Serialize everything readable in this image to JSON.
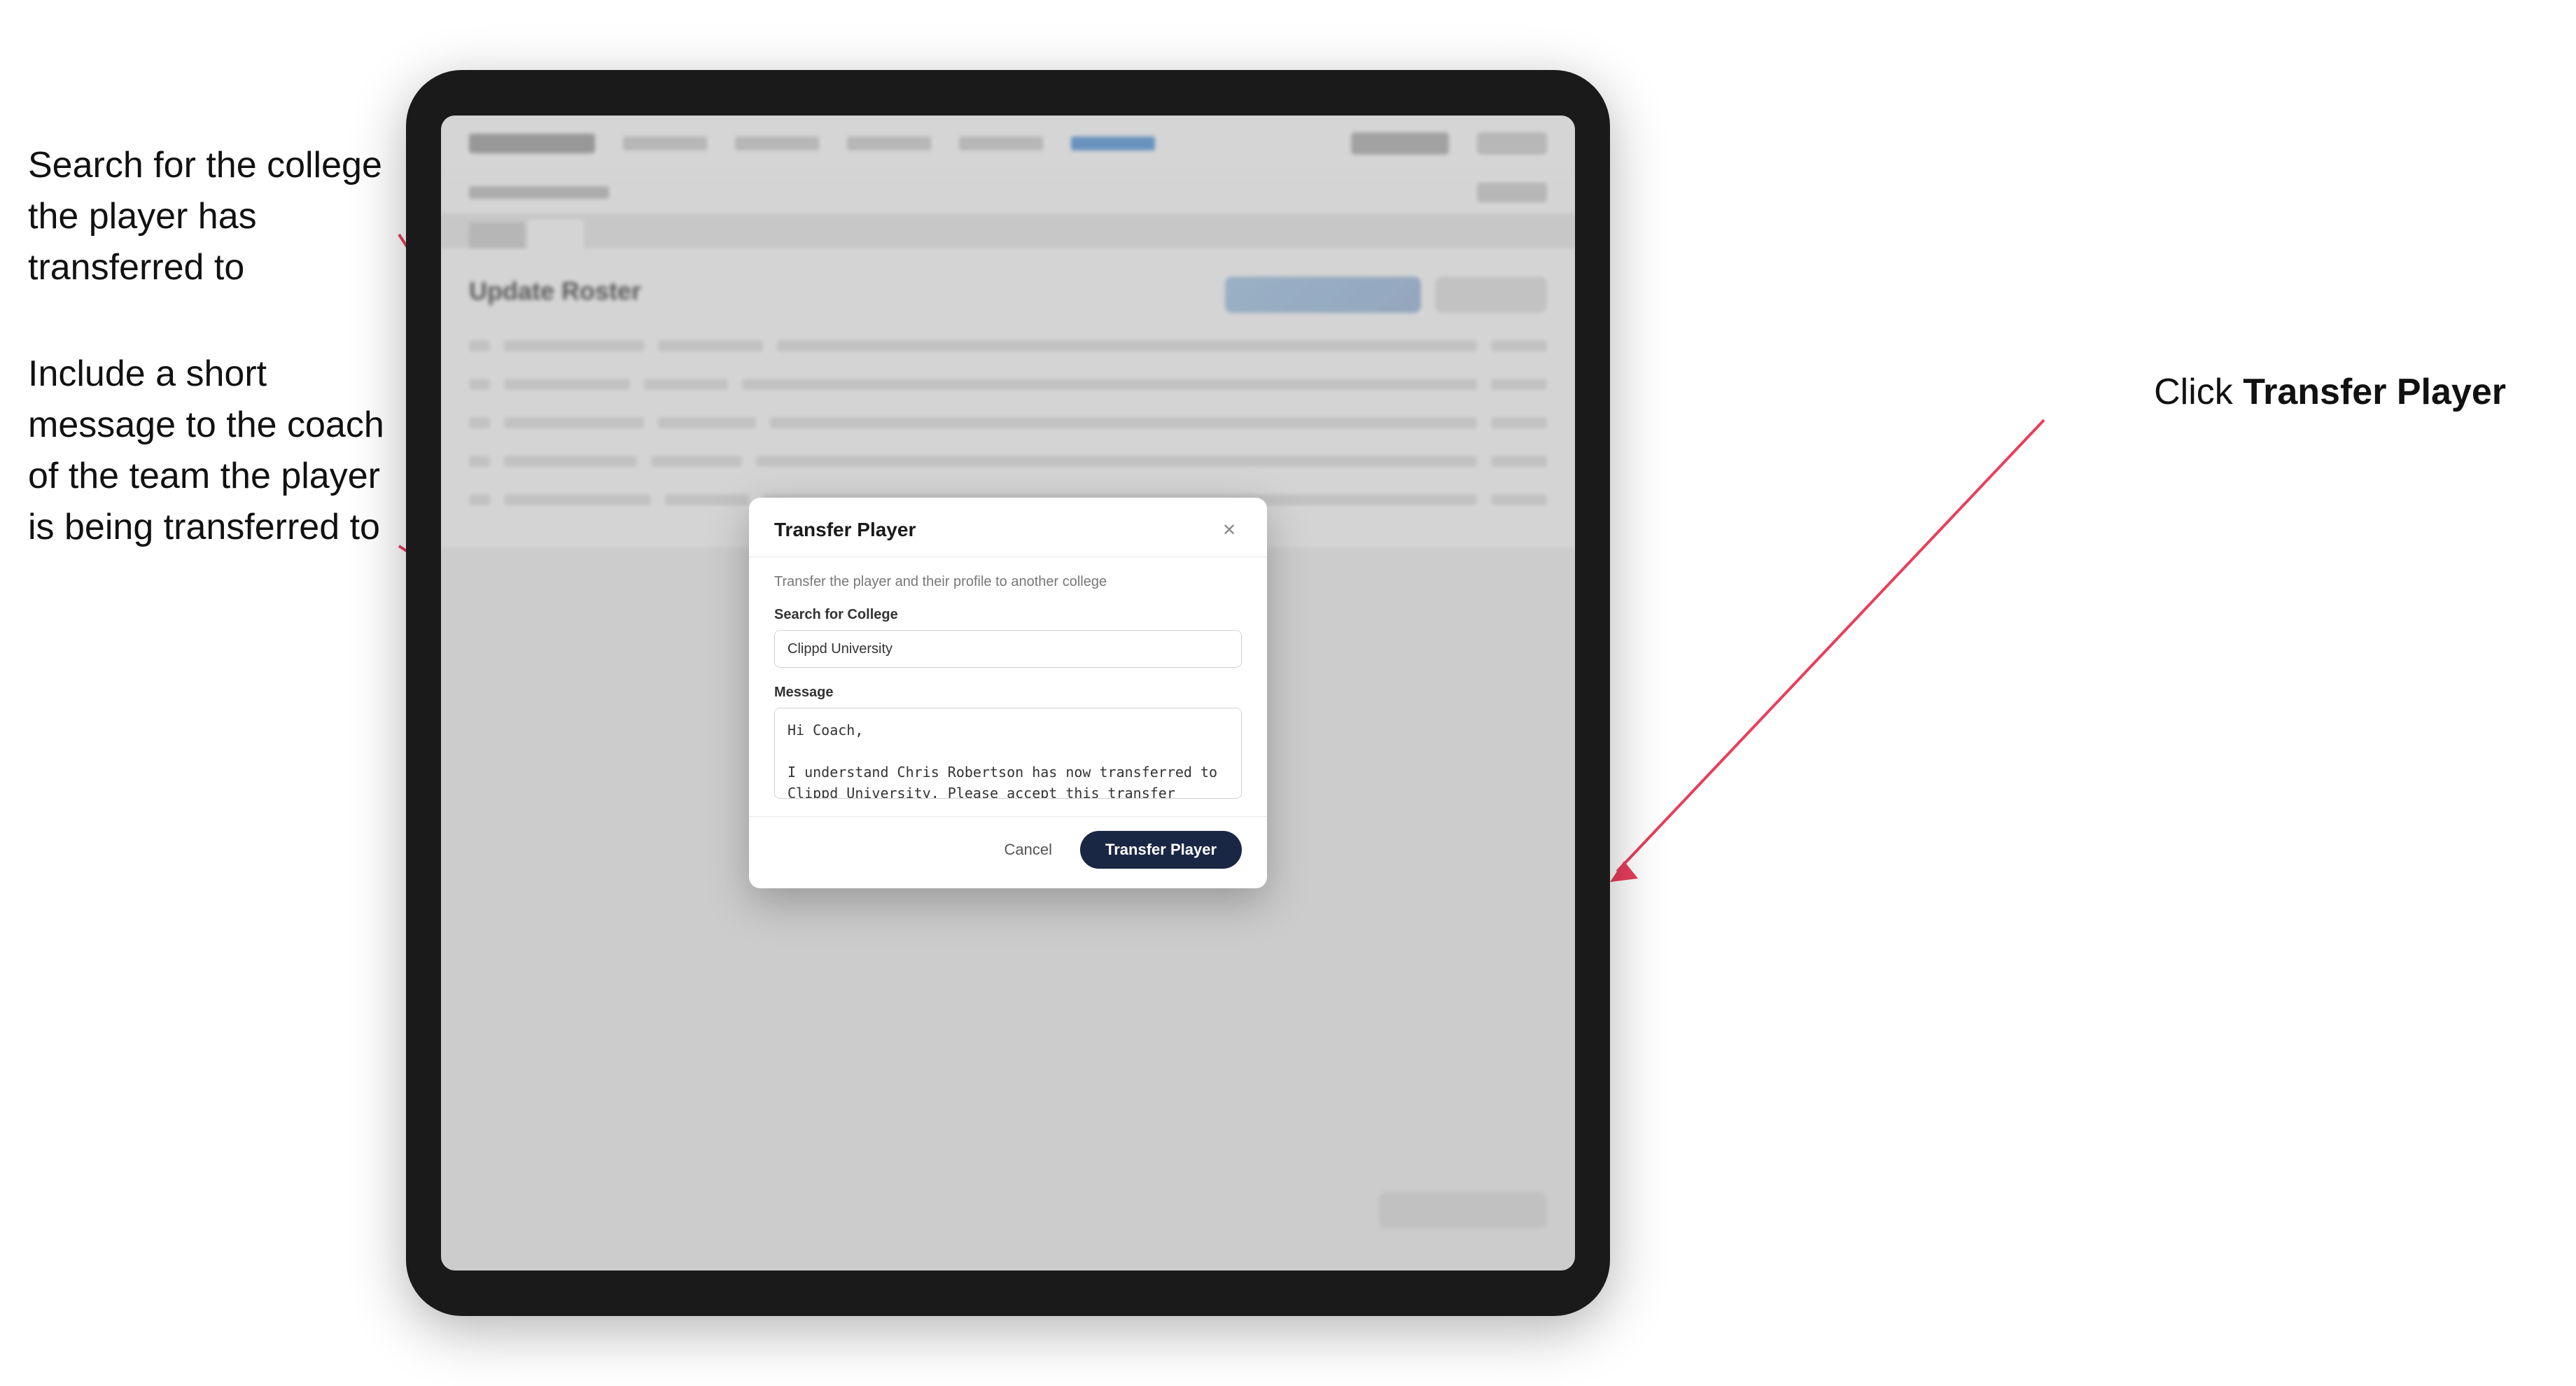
{
  "annotations": {
    "left_text_1": "Search for the college the player has transferred to",
    "left_text_2": "Include a short message to the coach of the team the player is being transferred to",
    "right_text_prefix": "Click ",
    "right_text_bold": "Transfer Player"
  },
  "modal": {
    "title": "Transfer Player",
    "subtitle": "Transfer the player and their profile to another college",
    "college_label": "Search for College",
    "college_value": "Clippd University",
    "message_label": "Message",
    "message_value": "Hi Coach,\n\nI understand Chris Robertson has now transferred to Clippd University. Please accept this transfer request when you can.",
    "cancel_label": "Cancel",
    "transfer_label": "Transfer Player"
  },
  "app": {
    "page_title": "Update Roster"
  }
}
